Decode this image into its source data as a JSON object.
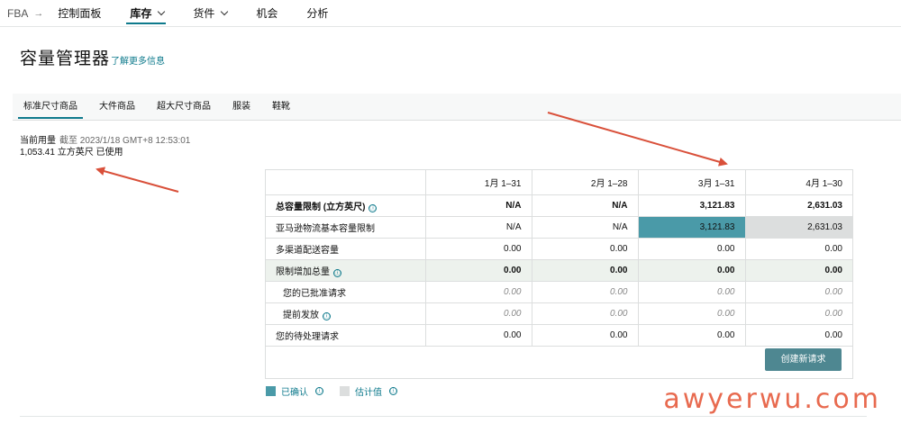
{
  "nav": {
    "crumb": "FBA",
    "items": [
      {
        "label": "控制面板",
        "has_menu": false,
        "active": false
      },
      {
        "label": "库存",
        "has_menu": true,
        "active": true
      },
      {
        "label": "货件",
        "has_menu": true,
        "active": false
      },
      {
        "label": "机会",
        "has_menu": false,
        "active": false
      },
      {
        "label": "分析",
        "has_menu": false,
        "active": false
      }
    ]
  },
  "page": {
    "title": "容量管理器",
    "learn_more": "了解更多信息"
  },
  "tabs": [
    "标准尺寸商品",
    "大件商品",
    "超大尺寸商品",
    "服装",
    "鞋靴"
  ],
  "usage": {
    "label": "当前用量",
    "as_of": "截至 2023/1/18 GMT+8 12:53:01",
    "value": "1,053.41 立方英尺 已使用"
  },
  "table": {
    "columns": [
      "1月 1–31",
      "2月 1–28",
      "3月 1–31",
      "4月 1–30"
    ],
    "rows": [
      {
        "label": "总容量限制 (立方英尺)",
        "values": [
          "N/A",
          "N/A",
          "3,121.83",
          "2,631.03"
        ]
      },
      {
        "label": "亚马逊物流基本容量限制",
        "values": [
          "N/A",
          "N/A",
          "3,121.83",
          "2,631.03"
        ]
      },
      {
        "label": "多渠道配送容量",
        "values": [
          "0.00",
          "0.00",
          "0.00",
          "0.00"
        ]
      },
      {
        "label": "限制增加总量",
        "values": [
          "0.00",
          "0.00",
          "0.00",
          "0.00"
        ]
      },
      {
        "label": "您的已批准请求",
        "values": [
          "0.00",
          "0.00",
          "0.00",
          "0.00"
        ]
      },
      {
        "label": "提前发放",
        "values": [
          "0.00",
          "0.00",
          "0.00",
          "0.00"
        ]
      },
      {
        "label": "您的待处理请求",
        "values": [
          "0.00",
          "0.00",
          "0.00",
          "0.00"
        ]
      }
    ],
    "create_button": "创建新请求"
  },
  "legend": {
    "confirmed": "已确认",
    "estimated": "估计值"
  },
  "colors": {
    "accent": "#0e7a8c",
    "confirmed": "#4a9aa8",
    "estimated": "#dcdede",
    "button": "#4e8791",
    "arrow": "#d9503a"
  },
  "watermark": "awyerwu.com",
  "info_icon": "ⓘ"
}
